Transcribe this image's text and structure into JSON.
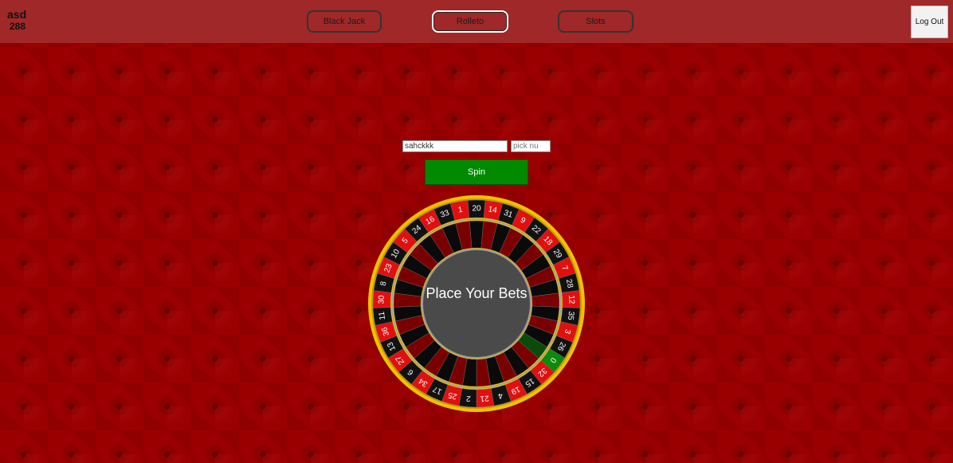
{
  "header": {
    "username": "asd",
    "balance": "288",
    "nav": [
      {
        "label": "Black Jack"
      },
      {
        "label": "Rolleto"
      },
      {
        "label": "Slots"
      }
    ],
    "logout_label": "Log Out"
  },
  "bet_form": {
    "amount_value": "sahckkk",
    "number_placeholder": "pick nu",
    "spin_label": "Spin"
  },
  "wheel": {
    "center_text": "Place Your Bets",
    "numbers": [
      "20",
      "14",
      "31",
      "9",
      "22",
      "18",
      "29",
      "7",
      "28",
      "12",
      "35",
      "3",
      "26",
      "0",
      "32",
      "15",
      "19",
      "4",
      "21",
      "2",
      "25",
      "17",
      "34",
      "6",
      "27",
      "13",
      "36",
      "11",
      "30",
      "8",
      "23",
      "10",
      "5",
      "24",
      "16",
      "33",
      "1"
    ],
    "colors": {
      "red": "#e01010",
      "black": "#111111",
      "green": "#0b8a0b",
      "rim": "#f2c200",
      "hub": "#4a4a4a"
    }
  }
}
